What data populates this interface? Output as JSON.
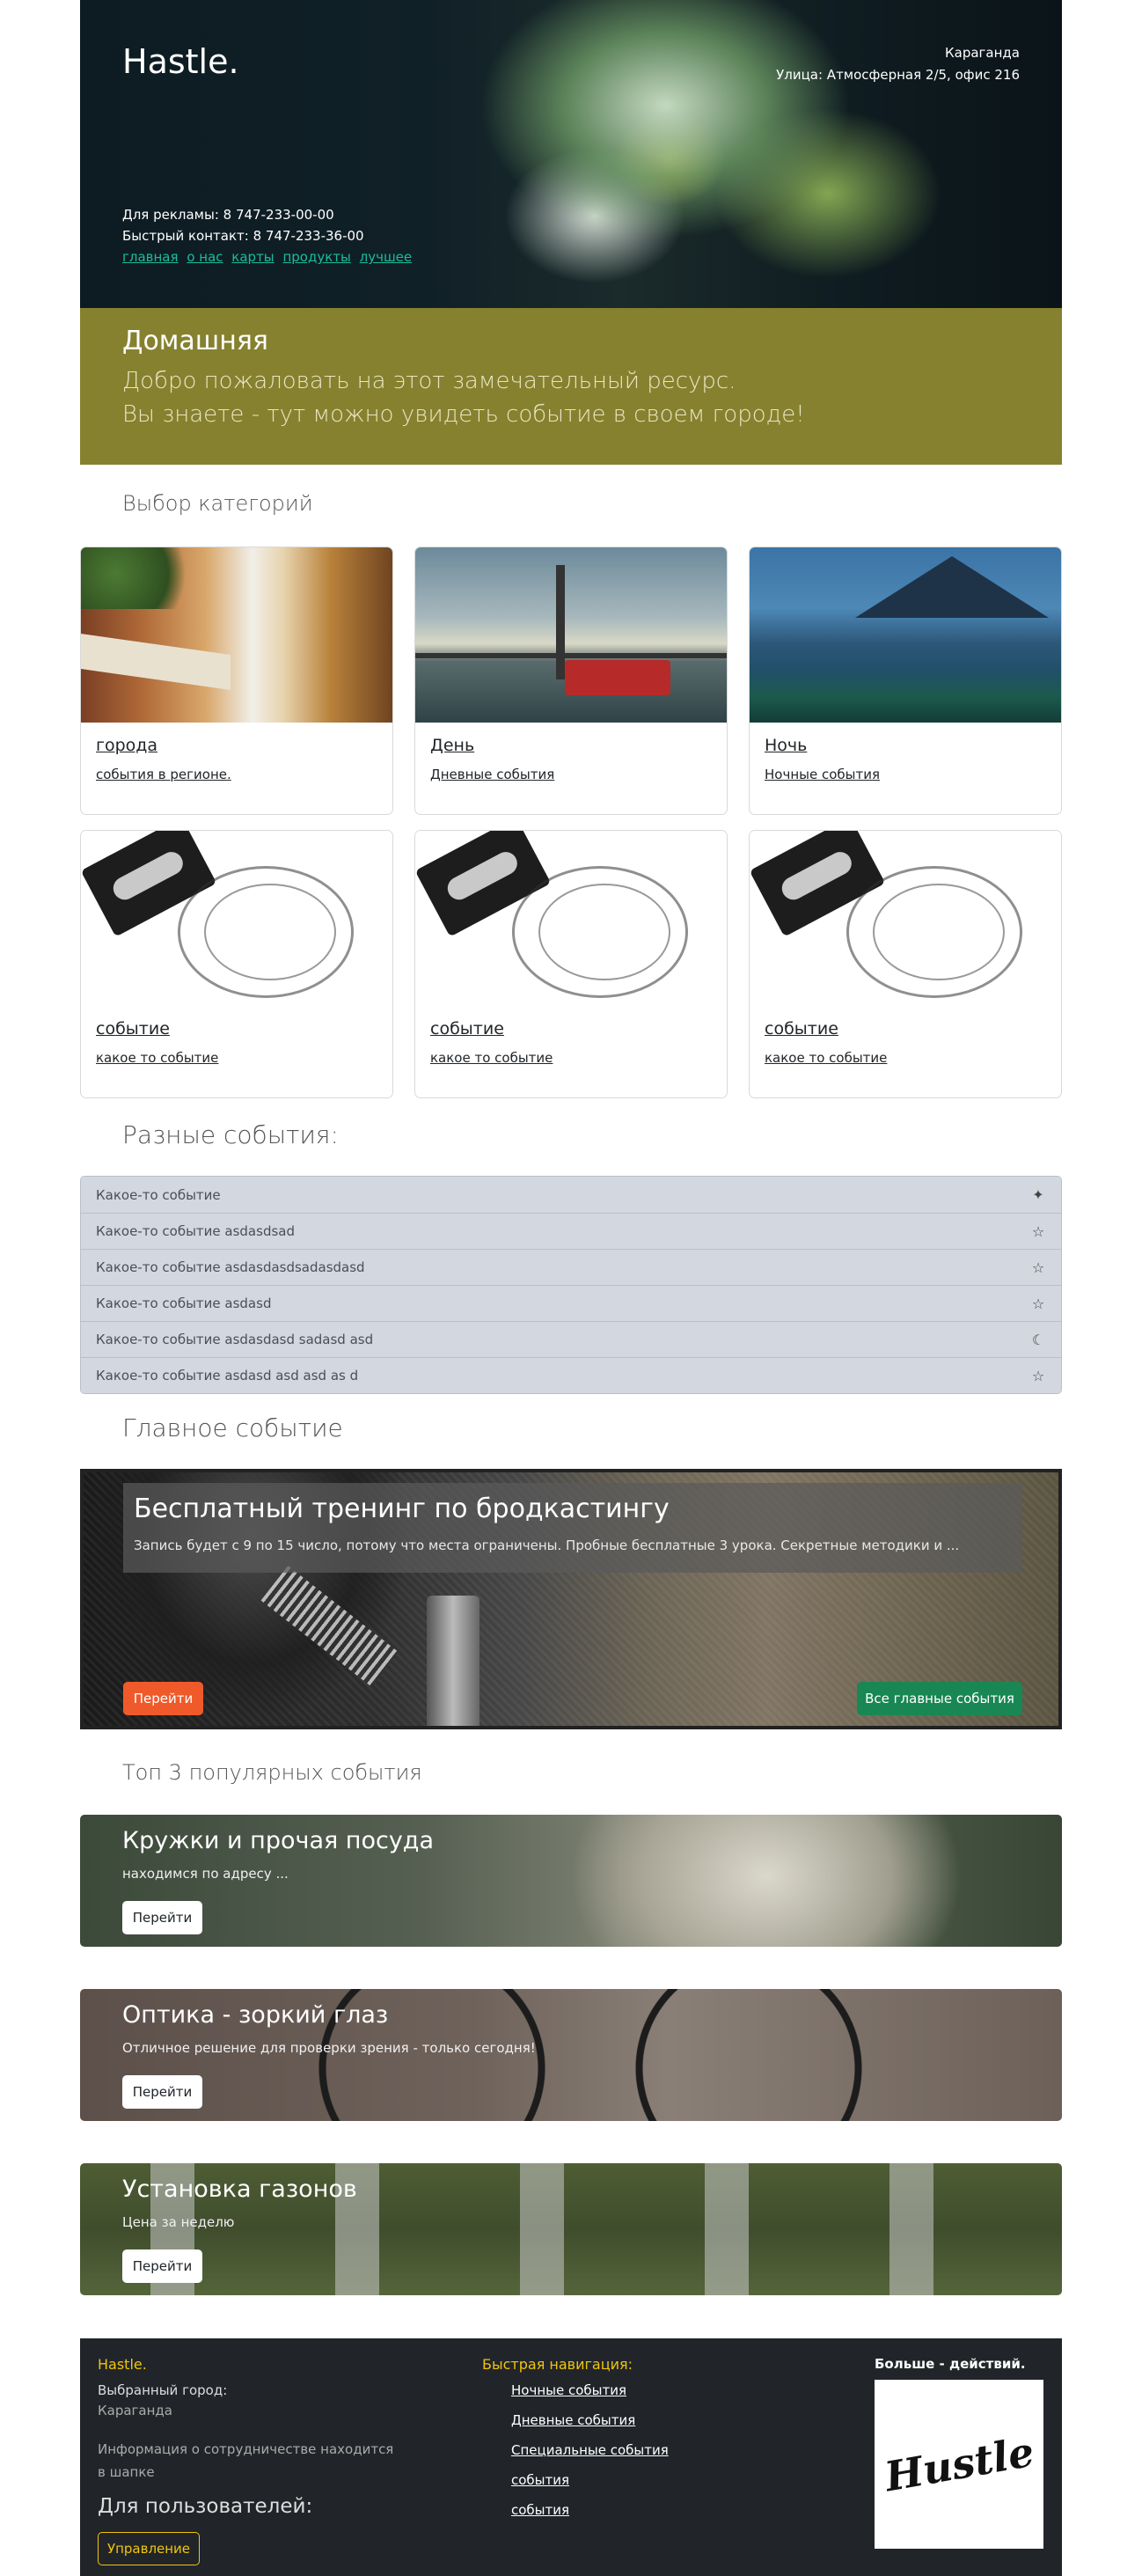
{
  "header": {
    "brand": "Hastle.",
    "city": "Караганда",
    "address": "Улица: Атмосферная 2/5, офис 216",
    "ads_contact": "Для рекламы: 8 747-233-00-00",
    "quick_contact": "Быстрый контакт: 8 747-233-36-00",
    "nav": [
      "главная",
      "о нас",
      "карты",
      "продукты",
      "лучшее"
    ]
  },
  "welcome": {
    "title": "Домашняя",
    "line1": "Добро пожаловать на этот замечательный ресурс.",
    "line2": "Вы знаете - тут можно увидеть событие в своем городе!"
  },
  "categories": {
    "heading": "Выбор категорий",
    "items": [
      {
        "title": "города",
        "subtitle": "события в регионе."
      },
      {
        "title": "День",
        "subtitle": "Дневные события"
      },
      {
        "title": "Ночь",
        "subtitle": "Ночные события"
      },
      {
        "title": "событие",
        "subtitle": "какое то событие"
      },
      {
        "title": "событие",
        "subtitle": "какое то событие"
      },
      {
        "title": "событие",
        "subtitle": "какое то событие"
      }
    ]
  },
  "events": {
    "heading": "Разные события:",
    "items": [
      {
        "label": "Какое-то событие",
        "icon": "sparkles-icon"
      },
      {
        "label": "Какое-то событие asdasdsad",
        "icon": "star-icon"
      },
      {
        "label": "Какое-то событие asdasdasdsadasdasd",
        "icon": "star-icon"
      },
      {
        "label": "Какое-то событие asdasd",
        "icon": "star-icon"
      },
      {
        "label": "Какое-то событие asdasdasd sadasd asd",
        "icon": "moon-stars-icon"
      },
      {
        "label": "Какое-то событие asdasd asd asd as d",
        "icon": "star-icon"
      }
    ]
  },
  "main_event": {
    "heading": "Главное событие",
    "title": "Бесплатный тренинг по бродкастингу",
    "description": "Запись будет с 9 по 15 число, потому что места ограничены. Пробные бесплатные 3 урока. Секретные методики и ...",
    "go_label": "Перейти",
    "all_label": "Все главные события",
    "go_color": "#f05a2a",
    "all_color": "#198754"
  },
  "top3": {
    "heading": "Топ 3 популярных события",
    "items": [
      {
        "title": "Кружки и прочая посуда",
        "subtitle": "находимся по адресу ...",
        "button": "Перейти"
      },
      {
        "title": "Оптика - зоркий глаз",
        "subtitle": "Отличное решение для проверки зрения - только сегодня!",
        "button": "Перейти"
      },
      {
        "title": "Установка газонов",
        "subtitle": "Цена за неделю",
        "button": "Перейти"
      }
    ]
  },
  "footer": {
    "brand": "Hastle.",
    "city_label": "Выбранный город:",
    "city_value": "Караганда",
    "info": "Информация о сотрудничестве находится в шапке",
    "users_heading": "Для пользователей:",
    "manage_button": "Управление",
    "nav_heading": "Быстрая навигация:",
    "nav_links": [
      "Ночные события",
      "Дневные события",
      "Специальные события",
      "события",
      "события"
    ],
    "more_heading": "Больше - действий.",
    "logo_text": "Hustle"
  },
  "colors": {
    "welcome_bg": "#86812f",
    "footer_bg": "#212529",
    "footer_accent": "#f1c40f",
    "header_link": "#1abc9c"
  }
}
